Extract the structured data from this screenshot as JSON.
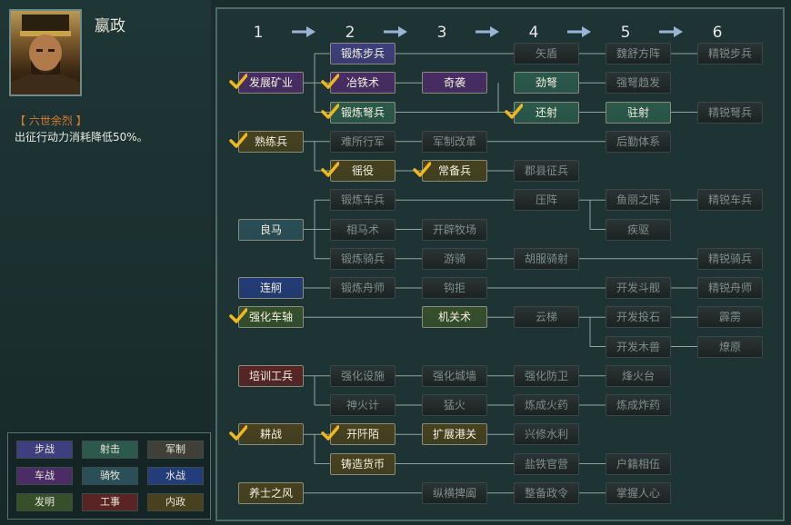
{
  "ruler": {
    "name": "嬴政"
  },
  "trait": {
    "name": "【 六世余烈 】",
    "desc": "出征行动力消耗降低50%。"
  },
  "columns": [
    "1",
    "2",
    "3",
    "4",
    "5",
    "6"
  ],
  "colors": {
    "infantry": "#3e3f7e",
    "archery": "#2b5a4c",
    "military": "#403f38",
    "chariot": "#4b2c66",
    "cavalry": "#2b4f58",
    "naval": "#233c7a",
    "invention": "#37502a",
    "engineering": "#5a2424",
    "domestic": "#48411e"
  },
  "legend": {
    "infantry": "步战",
    "archery": "射击",
    "military": "军制",
    "chariot": "车战",
    "cavalry": "骑牧",
    "naval": "水战",
    "invention": "发明",
    "engineering": "工事",
    "domestic": "内政"
  },
  "techs": {
    "r0c2": "锻炼步兵",
    "r0c4": "矢盾",
    "r0c5": "魏舒方阵",
    "r0c6": "精锐步兵",
    "r1c1": "发展矿业",
    "r1c2": "冶铁术",
    "r1c3": "奇袭",
    "r1c4": "劲弩",
    "r1c5": "强弩趋发",
    "r2c2": "锻炼弩兵",
    "r2c4": "还射",
    "r2c5": "驻射",
    "r2c6": "精锐弩兵",
    "r3c1": "熟练兵",
    "r3c2": "难所行军",
    "r3c3": "军制改革",
    "r3c5": "后勤体系",
    "r4c2": "徭役",
    "r4c3": "常备兵",
    "r4c4": "郡县征兵",
    "r5c2": "锻炼车兵",
    "r5c4": "压阵",
    "r5c5": "鱼丽之阵",
    "r5c6": "精锐车兵",
    "r6c1": "良马",
    "r6c2": "相马术",
    "r6c3": "开辟牧场",
    "r6c5": "疾驱",
    "r7c2": "锻炼骑兵",
    "r7c3": "游骑",
    "r7c4": "胡服骑射",
    "r7c6": "精锐骑兵",
    "r8c1": "连舸",
    "r8c2": "锻炼舟师",
    "r8c3": "钩拒",
    "r8c5": "开发斗舰",
    "r8c6": "精锐舟师",
    "r9c1": "强化车轴",
    "r9c3": "机关术",
    "r9c4": "云梯",
    "r9c5": "开发投石",
    "r9c6": "霹雳",
    "r10c5": "开发木兽",
    "r10c6": "燎原",
    "r11c1": "培训工兵",
    "r11c2": "强化设施",
    "r11c3": "强化城墙",
    "r11c4": "强化防卫",
    "r11c5": "烽火台",
    "r12c2": "神火计",
    "r12c3": "猛火",
    "r12c4": "炼成火药",
    "r12c5": "炼成炸药",
    "r13c1": "耕战",
    "r13c2": "开阡陌",
    "r13c3": "扩展港关",
    "r13c4": "兴修水利",
    "r14c2": "铸造货币",
    "r14c4": "盐铁官营",
    "r14c5": "户籍相伍",
    "r15c1": "养士之风",
    "r15c3": "纵横捭阖",
    "r15c4": "整备政令",
    "r15c5": "掌握人心"
  }
}
